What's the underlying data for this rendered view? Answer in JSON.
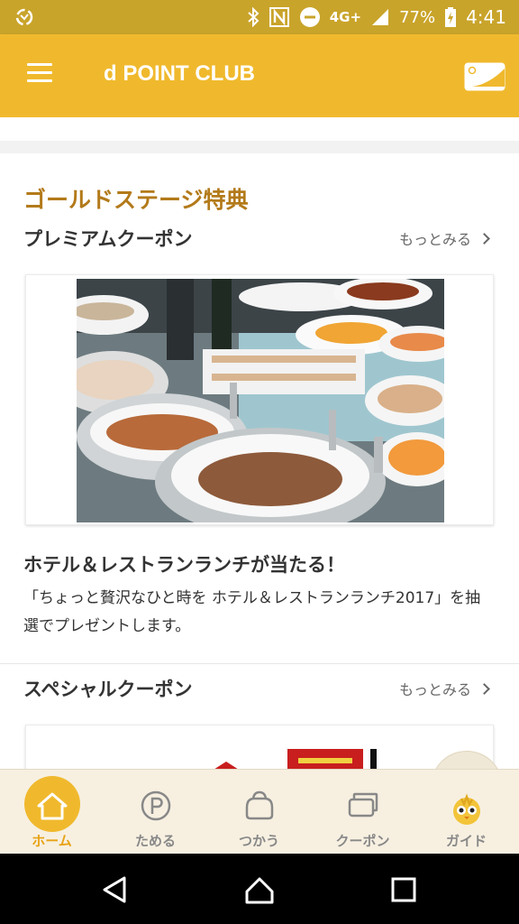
{
  "status_bar": {
    "network": "4G+",
    "battery": "77%",
    "time": "4:41"
  },
  "app_bar": {
    "title": "d POINT CLUB",
    "menu_icon": "hamburger-menu-icon",
    "card_icon": "dpoint-card-icon"
  },
  "main": {
    "stage_title": "ゴールドステージ特典",
    "premium": {
      "heading": "プレミアムクーポン",
      "more": "もっとみる",
      "coupon": {
        "title": "ホテル＆レストランランチが当たる！",
        "desc": "「ちょっと贅沢なひと時を ホテル＆レストランランチ2017」を抽選でプレゼントします。"
      }
    },
    "special": {
      "heading": "スペシャルクーポン",
      "more": "もっとみる"
    }
  },
  "bottom_nav": {
    "items": [
      {
        "label": "ホーム",
        "icon": "home-icon"
      },
      {
        "label": "ためる",
        "icon": "point-p-icon"
      },
      {
        "label": "つかう",
        "icon": "wallet-icon"
      },
      {
        "label": "クーポン",
        "icon": "coupon-icon"
      },
      {
        "label": "ガイド",
        "icon": "mascot-icon"
      }
    ]
  },
  "colors": {
    "accent": "#f0b92d",
    "status_bar": "#c9a42b",
    "stage_title": "#b37a1a",
    "nav_active": "#e8a317"
  }
}
